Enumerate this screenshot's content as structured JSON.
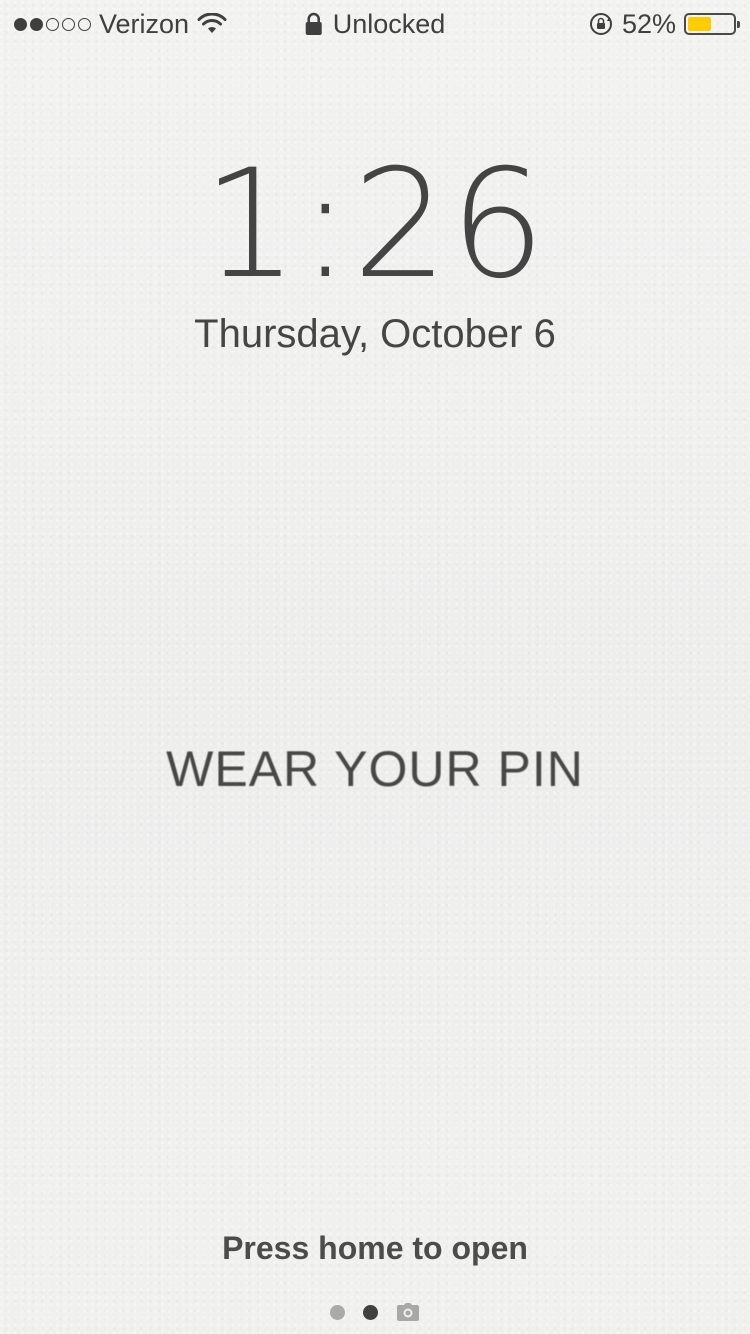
{
  "status_bar": {
    "signal_strength": 2,
    "signal_max": 5,
    "carrier": "Verizon",
    "lock_status": "Unlocked",
    "battery_percent": "52%",
    "battery_level": 0.52,
    "battery_color": "#ffcc00",
    "icons": [
      "signal-dots-icon",
      "wifi-icon",
      "lock-icon",
      "rotation-lock-icon",
      "battery-icon"
    ]
  },
  "lock_screen": {
    "time": "1:26",
    "date": "Thursday, October 6",
    "wallpaper_text": "WEAR YOUR PIN",
    "prompt": "Press home to open"
  },
  "page_indicator": {
    "pages": 2,
    "active_index": 1,
    "camera_icon": "camera-icon"
  }
}
